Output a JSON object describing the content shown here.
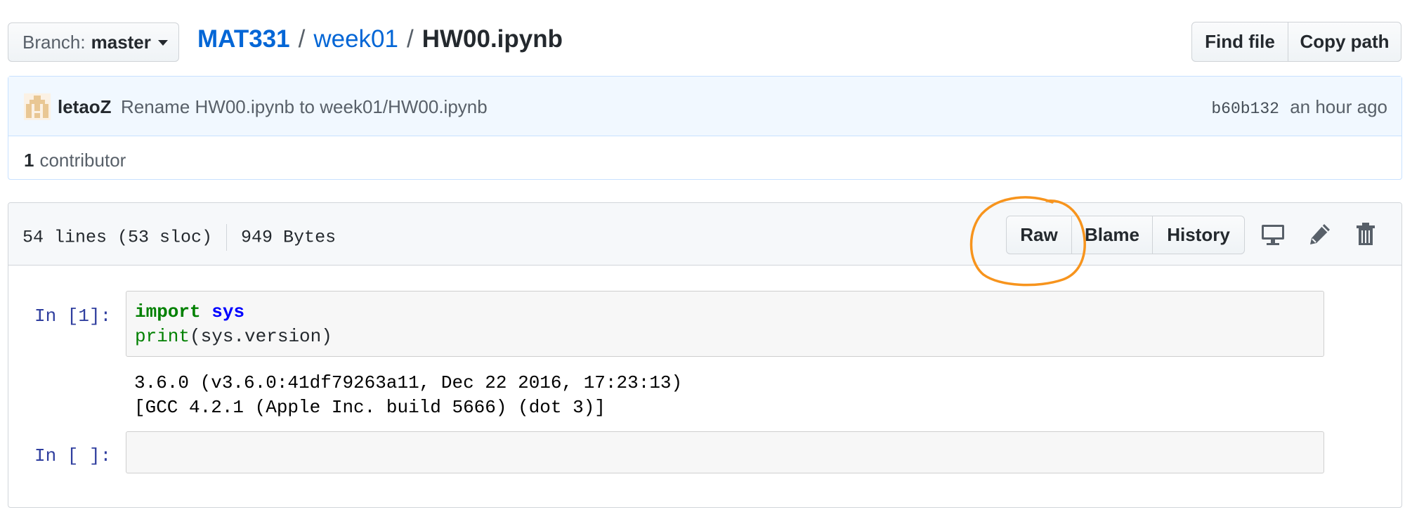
{
  "branch": {
    "label": "Branch:",
    "value": "master"
  },
  "breadcrumb": {
    "repo": "MAT331",
    "folder": "week01",
    "file": "HW00.ipynb",
    "separator": "/"
  },
  "file_actions": {
    "find_file": "Find file",
    "copy_path": "Copy path"
  },
  "commit": {
    "author": "letaoZ",
    "message": "Rename HW00.ipynb to week01/HW00.ipynb",
    "sha": "b60b132",
    "time": "an hour ago"
  },
  "contributors": {
    "count": "1",
    "label": "contributor"
  },
  "file_info": {
    "lines": "54 lines (53 sloc)",
    "size": "949 Bytes"
  },
  "toolbar": {
    "raw": "Raw",
    "blame": "Blame",
    "history": "History"
  },
  "icons": {
    "display": "desktop-icon",
    "edit": "pencil-icon",
    "delete": "trash-icon"
  },
  "notebook": {
    "cell1": {
      "prompt": "In [1]:",
      "code": {
        "import_kw": "import",
        "module": "sys",
        "print_fn": "print",
        "args": "(sys.version)"
      },
      "output": [
        "3.6.0 (v3.6.0:41df79263a11, Dec 22 2016, 17:23:13)",
        "[GCC 4.2.1 (Apple Inc. build 5666) (dot 3)]"
      ]
    },
    "cell2": {
      "prompt": "In [ ]:"
    }
  },
  "colors": {
    "link": "#0366d6",
    "annotation": "#f7941d",
    "prompt": "#303f9f",
    "keyword": "#008000",
    "name": "#0000ff"
  }
}
